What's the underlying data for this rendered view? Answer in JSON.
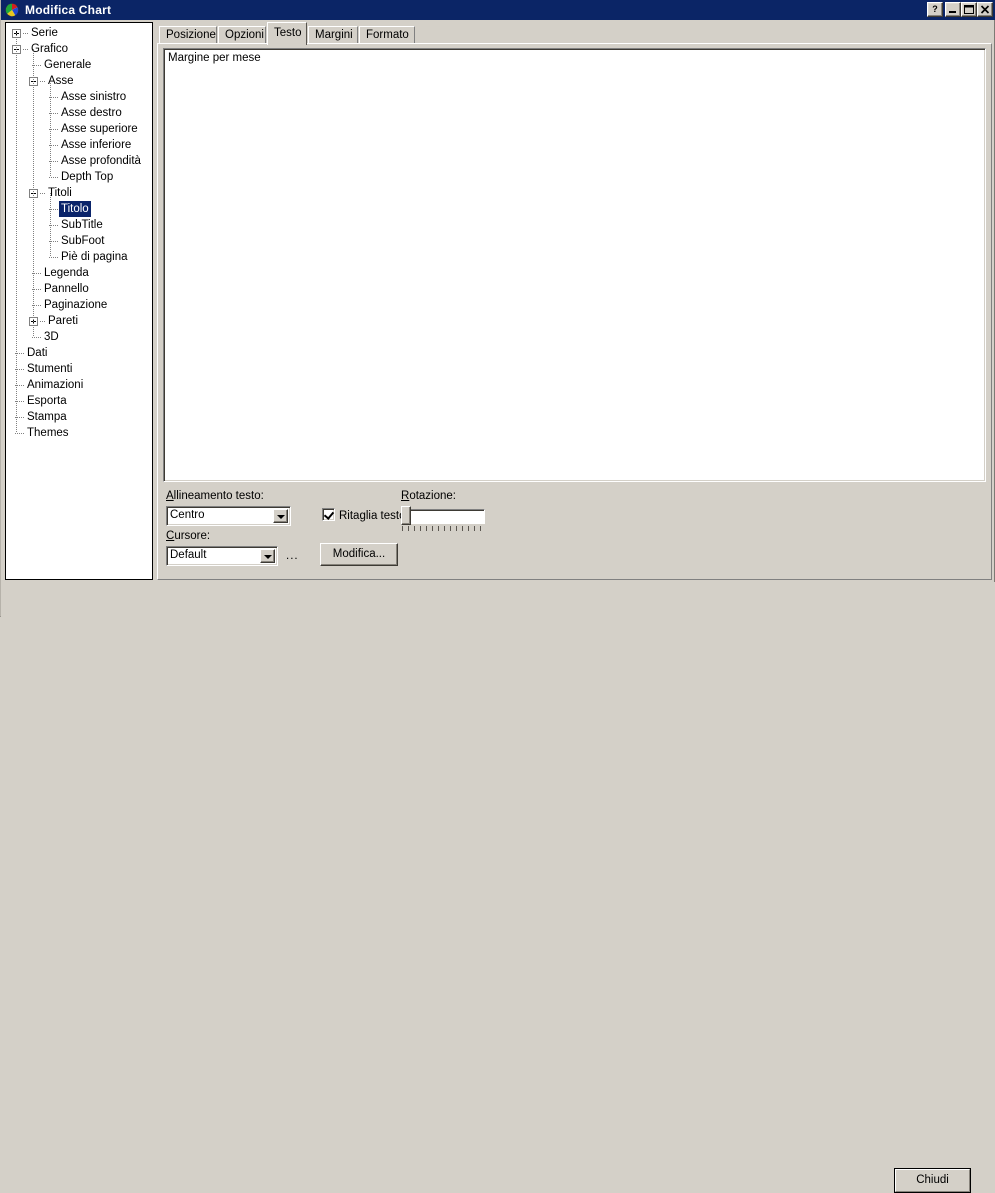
{
  "window": {
    "title": "Modifica Chart",
    "icon": "teechart-logo-icon",
    "controls": {
      "help": "?",
      "minimize": "minimize-icon",
      "maximize": "maximize-icon",
      "close": "close-icon"
    }
  },
  "tree": {
    "selected": "Titolo",
    "items": [
      {
        "label": "Serie",
        "depth": 0,
        "expander": "plus"
      },
      {
        "label": "Grafico",
        "depth": 0,
        "expander": "minus"
      },
      {
        "label": "Generale",
        "depth": 1,
        "expander": "none"
      },
      {
        "label": "Asse",
        "depth": 1,
        "expander": "minus"
      },
      {
        "label": "Asse sinistro",
        "depth": 2,
        "expander": "none"
      },
      {
        "label": "Asse destro",
        "depth": 2,
        "expander": "none"
      },
      {
        "label": "Asse superiore",
        "depth": 2,
        "expander": "none"
      },
      {
        "label": "Asse inferiore",
        "depth": 2,
        "expander": "none"
      },
      {
        "label": "Asse profondità",
        "depth": 2,
        "expander": "none"
      },
      {
        "label": "Depth Top",
        "depth": 2,
        "expander": "none"
      },
      {
        "label": "Titoli",
        "depth": 1,
        "expander": "minus"
      },
      {
        "label": "Titolo",
        "depth": 2,
        "expander": "none"
      },
      {
        "label": "SubTitle",
        "depth": 2,
        "expander": "none"
      },
      {
        "label": "SubFoot",
        "depth": 2,
        "expander": "none"
      },
      {
        "label": "Piè di pagina",
        "depth": 2,
        "expander": "none"
      },
      {
        "label": "Legenda",
        "depth": 1,
        "expander": "none"
      },
      {
        "label": "Pannello",
        "depth": 1,
        "expander": "none"
      },
      {
        "label": "Paginazione",
        "depth": 1,
        "expander": "none"
      },
      {
        "label": "Pareti",
        "depth": 1,
        "expander": "plus"
      },
      {
        "label": "3D",
        "depth": 1,
        "expander": "none"
      },
      {
        "label": "Dati",
        "depth": 0,
        "expander": "none"
      },
      {
        "label": "Stumenti",
        "depth": 0,
        "expander": "none"
      },
      {
        "label": "Animazioni",
        "depth": 0,
        "expander": "none"
      },
      {
        "label": "Esporta",
        "depth": 0,
        "expander": "none"
      },
      {
        "label": "Stampa",
        "depth": 0,
        "expander": "none"
      },
      {
        "label": "Themes",
        "depth": 0,
        "expander": "none"
      }
    ]
  },
  "tabs": {
    "active": "Testo",
    "items": [
      {
        "label": "Posizione"
      },
      {
        "label": "Opzioni"
      },
      {
        "label": "Testo"
      },
      {
        "label": "Margini"
      },
      {
        "label": "Formato"
      }
    ]
  },
  "memo": {
    "value": "Margine per mese",
    "placeholder": ""
  },
  "options": {
    "text_align_label": "Allineamento testo:",
    "text_align_value": "Centro",
    "cursor_label": "Cursore:",
    "cursor_value": "Default",
    "ellipsis_label": "...",
    "edit_button_label": "Modifica...",
    "clip_text_label": "Ritaglia testo",
    "clip_text_checked": true,
    "rotation_label": "Rotazione:",
    "rotation_value": 0
  },
  "footer": {
    "close_label": "Chiudi"
  },
  "colors": {
    "titlebar": "#0b2566",
    "face": "#d4d0c8",
    "selection": "#0a246a",
    "field": "#ffffff"
  }
}
